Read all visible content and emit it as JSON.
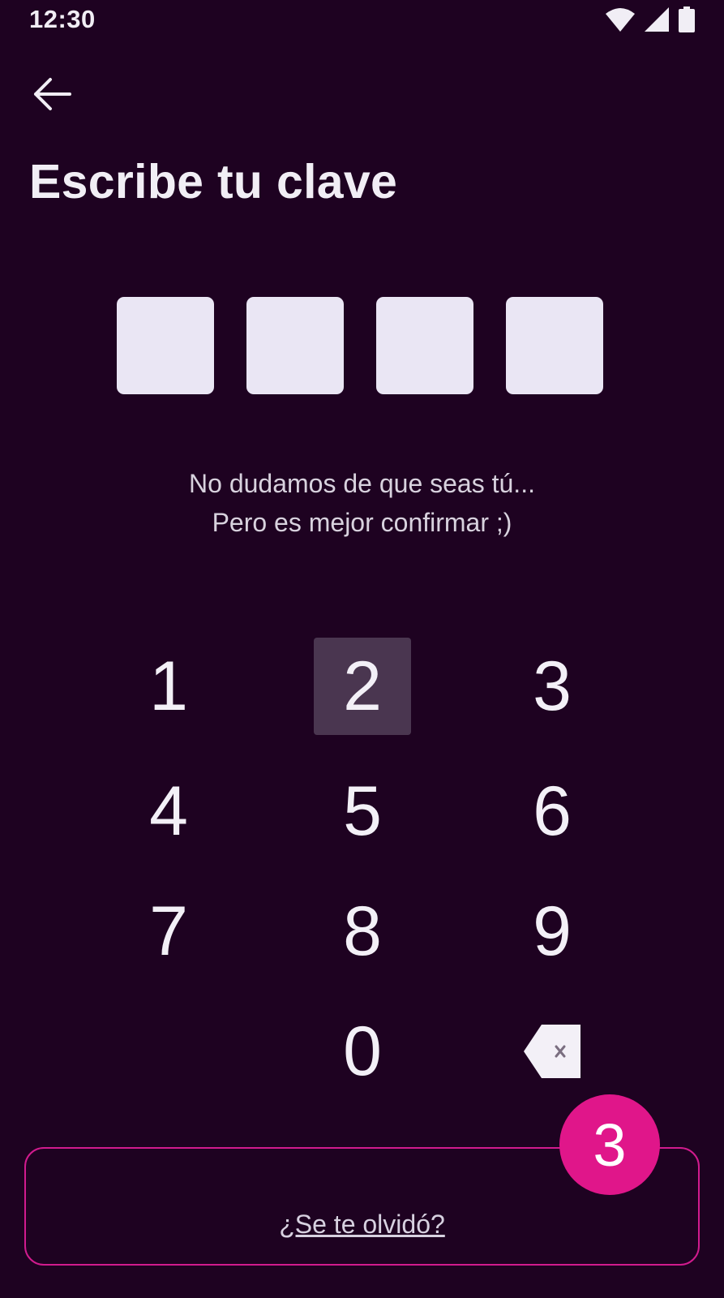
{
  "status_bar": {
    "time": "12:30",
    "icons": [
      "wifi-icon",
      "cellular-signal-icon",
      "battery-icon"
    ]
  },
  "header": {
    "back_icon": "arrow-left-icon"
  },
  "page": {
    "title": "Escribe tu clave",
    "pin_length": 4,
    "subtitle_line1": "No dudamos de que seas tú...",
    "subtitle_line2": "Pero es mejor confirmar ;)"
  },
  "keypad": {
    "keys": [
      "1",
      "2",
      "3",
      "4",
      "5",
      "6",
      "7",
      "8",
      "9",
      "0"
    ],
    "pressed_key": "2",
    "delete_icon": "backspace-icon"
  },
  "footer": {
    "forgot_label": "¿Se te olvidó?"
  },
  "annotation": {
    "step_number": "3"
  },
  "colors": {
    "background": "#1e0221",
    "pin_box": "#eae6f4",
    "accent": "#e0168a",
    "pressed_key": "#4a3650",
    "text": "#f1eef5"
  }
}
